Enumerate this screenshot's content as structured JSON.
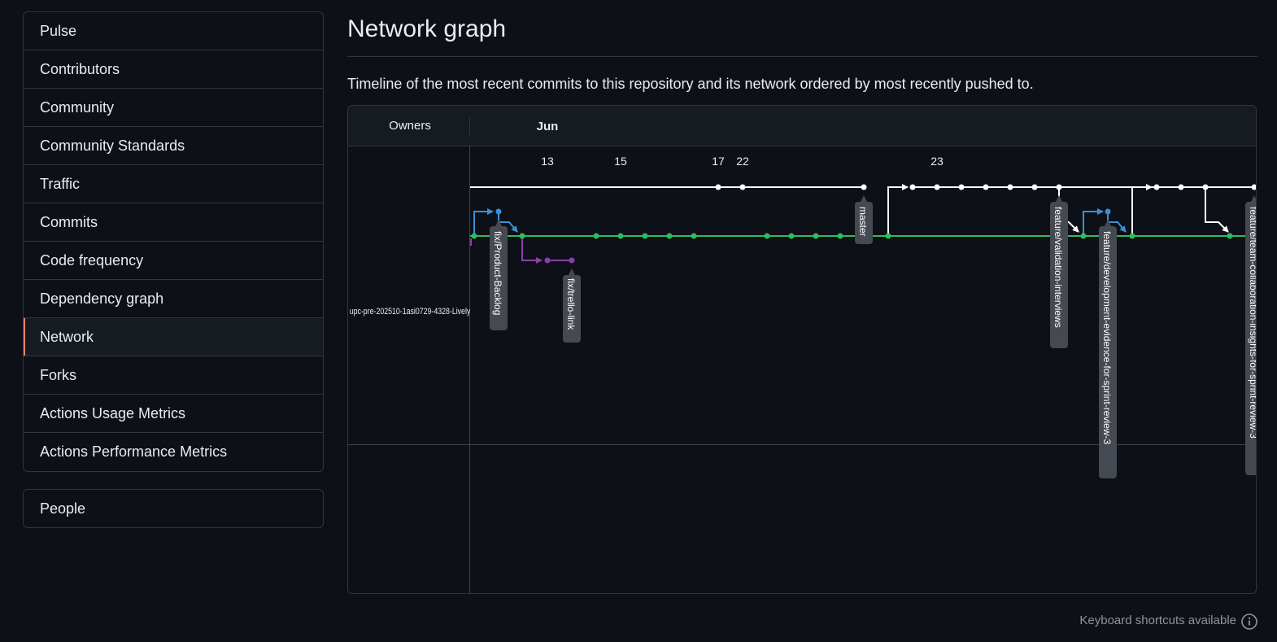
{
  "sidebar": {
    "items": [
      {
        "label": "Pulse",
        "active": false
      },
      {
        "label": "Contributors",
        "active": false
      },
      {
        "label": "Community",
        "active": false
      },
      {
        "label": "Community Standards",
        "active": false
      },
      {
        "label": "Traffic",
        "active": false
      },
      {
        "label": "Commits",
        "active": false
      },
      {
        "label": "Code frequency",
        "active": false
      },
      {
        "label": "Dependency graph",
        "active": false
      },
      {
        "label": "Network",
        "active": true
      },
      {
        "label": "Forks",
        "active": false
      },
      {
        "label": "Actions Usage Metrics",
        "active": false
      },
      {
        "label": "Actions Performance Metrics",
        "active": false
      }
    ],
    "people": "People"
  },
  "page": {
    "title": "Network graph",
    "description": "Timeline of the most recent commits to this repository and its network ordered by most recently pushed to."
  },
  "graph": {
    "owners_header": "Owners",
    "month": "Jun",
    "owner": "upc-pre-202510-1asi0729-4328-Lively",
    "day_labels": [
      "13",
      "15",
      "17",
      "22",
      "23"
    ],
    "branches": [
      "fix/Product-Backlog",
      "fix/trello-link",
      "master",
      "feature/validation-interviews",
      "feature/development-evidence-for-sprint-review-3",
      "feature/team-collaboration-insights-for-sprint-review-3"
    ],
    "colors": {
      "master": "#ffffff",
      "develop": "#2ebd5c",
      "fix_blue": "#3b8fd9",
      "fix_purple": "#8b3fa8",
      "label_bg": "#454a52"
    }
  },
  "footer": {
    "keyboard": "Keyboard shortcuts available"
  },
  "icons": {
    "info": "info-icon"
  }
}
